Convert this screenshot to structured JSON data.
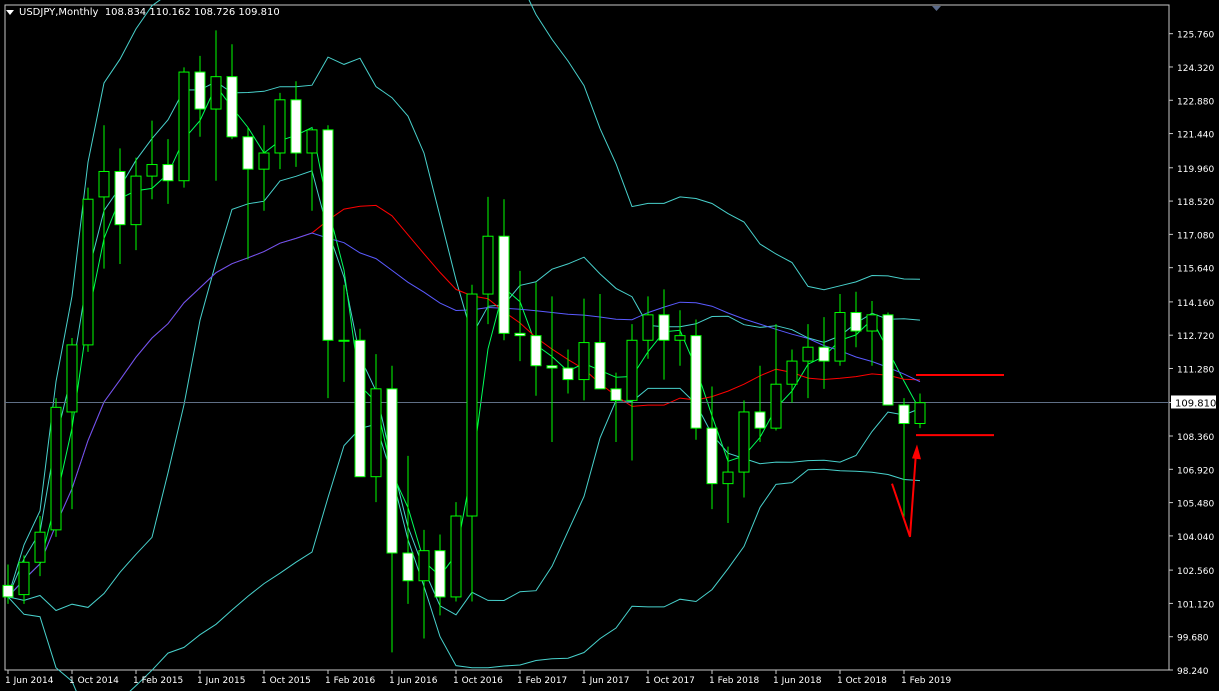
{
  "header": {
    "symbol_timeframe": "USDJPY,Monthly",
    "ohlc": "108.834 110.162 108.726 109.810"
  },
  "chart_data": {
    "type": "candlestick",
    "symbol": "USDJPY",
    "timeframe": "Monthly",
    "ylim": [
      98.24,
      127.0
    ],
    "y_ticks": [
      "125.760",
      "124.320",
      "122.880",
      "121.440",
      "119.960",
      "118.520",
      "117.080",
      "115.640",
      "114.160",
      "112.720",
      "111.280",
      "109.810",
      "108.360",
      "106.920",
      "105.480",
      "104.040",
      "102.560",
      "101.120",
      "99.680",
      "98.240"
    ],
    "x_ticks": [
      {
        "label": "1 Jun 2014",
        "index": 0
      },
      {
        "label": "1 Oct 2014",
        "index": 4
      },
      {
        "label": "1 Feb 2015",
        "index": 8
      },
      {
        "label": "1 Jun 2015",
        "index": 12
      },
      {
        "label": "1 Oct 2015",
        "index": 16
      },
      {
        "label": "1 Feb 2016",
        "index": 20
      },
      {
        "label": "1 Jun 2016",
        "index": 24
      },
      {
        "label": "1 Oct 2016",
        "index": 28
      },
      {
        "label": "1 Feb 2017",
        "index": 32
      },
      {
        "label": "1 Jun 2017",
        "index": 36
      },
      {
        "label": "1 Oct 2017",
        "index": 40
      },
      {
        "label": "1 Feb 2018",
        "index": 44
      },
      {
        "label": "1 Jun 2018",
        "index": 48
      },
      {
        "label": "1 Oct 2018",
        "index": 52
      },
      {
        "label": "1 Feb 2019",
        "index": 56
      }
    ],
    "current_price": "109.810",
    "candles": [
      {
        "o": 101.9,
        "h": 102.8,
        "l": 101.1,
        "c": 101.4
      },
      {
        "o": 101.5,
        "h": 103.2,
        "l": 101.1,
        "c": 102.9
      },
      {
        "o": 102.9,
        "h": 104.9,
        "l": 102.3,
        "c": 104.2
      },
      {
        "o": 104.3,
        "h": 110.0,
        "l": 104.0,
        "c": 109.6
      },
      {
        "o": 109.4,
        "h": 112.6,
        "l": 105.2,
        "c": 112.3
      },
      {
        "o": 112.3,
        "h": 119.1,
        "l": 112.0,
        "c": 118.6
      },
      {
        "o": 118.7,
        "h": 121.8,
        "l": 115.6,
        "c": 119.8
      },
      {
        "o": 119.8,
        "h": 120.8,
        "l": 115.8,
        "c": 117.5
      },
      {
        "o": 117.5,
        "h": 120.4,
        "l": 116.4,
        "c": 119.6
      },
      {
        "o": 119.6,
        "h": 122.0,
        "l": 118.6,
        "c": 120.1
      },
      {
        "o": 120.1,
        "h": 121.2,
        "l": 118.4,
        "c": 119.4
      },
      {
        "o": 119.4,
        "h": 124.3,
        "l": 119.1,
        "c": 124.1
      },
      {
        "o": 124.1,
        "h": 124.8,
        "l": 121.3,
        "c": 122.5
      },
      {
        "o": 122.5,
        "h": 125.9,
        "l": 119.4,
        "c": 123.9
      },
      {
        "o": 123.9,
        "h": 125.3,
        "l": 121.2,
        "c": 121.3
      },
      {
        "o": 121.3,
        "h": 121.7,
        "l": 116.0,
        "c": 119.9
      },
      {
        "o": 119.9,
        "h": 121.8,
        "l": 118.1,
        "c": 120.6
      },
      {
        "o": 120.6,
        "h": 123.2,
        "l": 119.9,
        "c": 122.9
      },
      {
        "o": 122.9,
        "h": 123.7,
        "l": 120.0,
        "c": 120.6
      },
      {
        "o": 120.6,
        "h": 121.4,
        "l": 118.1,
        "c": 121.6
      },
      {
        "o": 121.6,
        "h": 121.8,
        "l": 110.0,
        "c": 112.5
      },
      {
        "o": 112.5,
        "h": 114.9,
        "l": 110.7,
        "c": 112.5
      },
      {
        "o": 112.5,
        "h": 113.0,
        "l": 107.6,
        "c": 106.6
      },
      {
        "o": 106.6,
        "h": 111.9,
        "l": 105.5,
        "c": 110.4
      },
      {
        "o": 110.4,
        "h": 111.4,
        "l": 99.0,
        "c": 103.3
      },
      {
        "o": 103.3,
        "h": 107.5,
        "l": 101.1,
        "c": 102.1
      },
      {
        "o": 102.1,
        "h": 104.3,
        "l": 99.6,
        "c": 103.4
      },
      {
        "o": 103.4,
        "h": 104.1,
        "l": 100.6,
        "c": 101.4
      },
      {
        "o": 101.4,
        "h": 105.5,
        "l": 101.2,
        "c": 104.9
      },
      {
        "o": 104.9,
        "h": 114.9,
        "l": 101.2,
        "c": 114.5
      },
      {
        "o": 114.5,
        "h": 118.7,
        "l": 113.2,
        "c": 117.0
      },
      {
        "o": 117.0,
        "h": 118.6,
        "l": 112.5,
        "c": 112.8
      },
      {
        "o": 112.8,
        "h": 115.5,
        "l": 111.6,
        "c": 112.7
      },
      {
        "o": 112.7,
        "h": 115.0,
        "l": 110.1,
        "c": 111.4
      },
      {
        "o": 111.4,
        "h": 114.4,
        "l": 108.1,
        "c": 111.3
      },
      {
        "o": 111.3,
        "h": 112.1,
        "l": 110.2,
        "c": 110.8
      },
      {
        "o": 110.8,
        "h": 114.3,
        "l": 109.9,
        "c": 112.4
      },
      {
        "o": 112.4,
        "h": 114.5,
        "l": 110.6,
        "c": 110.4
      },
      {
        "o": 110.4,
        "h": 111.1,
        "l": 108.1,
        "c": 109.9
      },
      {
        "o": 109.9,
        "h": 113.2,
        "l": 107.3,
        "c": 112.5
      },
      {
        "o": 112.5,
        "h": 114.4,
        "l": 111.7,
        "c": 113.6
      },
      {
        "o": 113.6,
        "h": 114.7,
        "l": 110.8,
        "c": 112.5
      },
      {
        "o": 112.5,
        "h": 113.8,
        "l": 111.4,
        "c": 112.7
      },
      {
        "o": 112.7,
        "h": 113.4,
        "l": 108.2,
        "c": 108.7
      },
      {
        "o": 108.7,
        "h": 110.5,
        "l": 105.2,
        "c": 106.3
      },
      {
        "o": 106.3,
        "h": 107.9,
        "l": 104.6,
        "c": 106.8
      },
      {
        "o": 106.8,
        "h": 109.9,
        "l": 105.7,
        "c": 109.4
      },
      {
        "o": 109.4,
        "h": 111.4,
        "l": 108.1,
        "c": 108.7
      },
      {
        "o": 108.7,
        "h": 113.2,
        "l": 108.6,
        "c": 110.6
      },
      {
        "o": 110.6,
        "h": 112.1,
        "l": 109.8,
        "c": 111.6
      },
      {
        "o": 111.6,
        "h": 113.2,
        "l": 110.0,
        "c": 112.2
      },
      {
        "o": 112.2,
        "h": 113.5,
        "l": 110.4,
        "c": 111.6
      },
      {
        "o": 111.6,
        "h": 114.5,
        "l": 111.4,
        "c": 113.7
      },
      {
        "o": 113.7,
        "h": 114.6,
        "l": 112.2,
        "c": 112.9
      },
      {
        "o": 112.9,
        "h": 114.2,
        "l": 111.4,
        "c": 113.6
      },
      {
        "o": 113.6,
        "h": 113.7,
        "l": 109.8,
        "c": 109.7
      },
      {
        "o": 109.7,
        "h": 110.0,
        "l": 104.8,
        "c": 108.9
      },
      {
        "o": 108.9,
        "h": 110.2,
        "l": 108.7,
        "c": 109.8
      }
    ],
    "overlays": [
      {
        "name": "",
        "color": "#00ff5a",
        "kind": "ma"
      },
      {
        "name": "",
        "color": "#ff0000",
        "kind": "ma"
      },
      {
        "name": "",
        "color": "#5a5aff",
        "kind": "ma"
      },
      {
        "name": "",
        "color": "#48d1cc",
        "kind": "bands"
      }
    ],
    "annotations": {
      "color": "#ff0000",
      "horizontal_levels": [
        111.0,
        108.4
      ]
    }
  }
}
